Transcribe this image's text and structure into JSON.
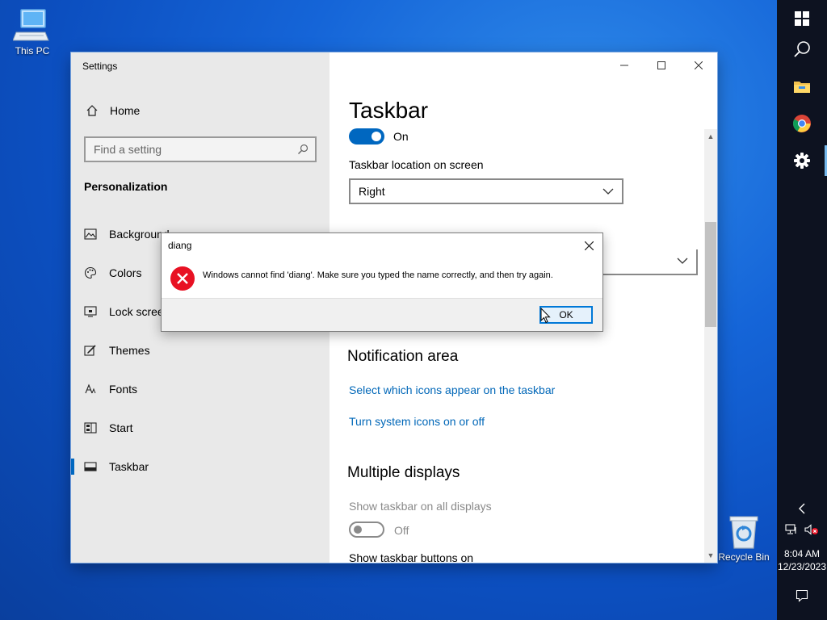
{
  "desktop": {
    "this_pc_label": "This PC",
    "recycle_bin_label": "Recycle Bin"
  },
  "settings": {
    "window_title": "Settings",
    "home_label": "Home",
    "search_placeholder": "Find a setting",
    "section_heading": "Personalization",
    "nav_items": [
      {
        "label": "Background",
        "icon": "picture-icon"
      },
      {
        "label": "Colors",
        "icon": "palette-icon"
      },
      {
        "label": "Lock screen",
        "icon": "lock-screen-icon"
      },
      {
        "label": "Themes",
        "icon": "brush-icon"
      },
      {
        "label": "Fonts",
        "icon": "font-icon"
      },
      {
        "label": "Start",
        "icon": "start-grid-icon"
      },
      {
        "label": "Taskbar",
        "icon": "taskbar-icon"
      }
    ],
    "active_nav": "Taskbar",
    "page_title": "Taskbar",
    "toggle_on_label": "On",
    "location_label": "Taskbar location on screen",
    "location_value": "Right",
    "notification_heading": "Notification area",
    "link_icons": "Select which icons appear on the taskbar",
    "link_system_icons": "Turn system icons on or off",
    "multiple_displays_heading": "Multiple displays",
    "show_all_displays_label": "Show taskbar on all displays",
    "toggle_off_label": "Off",
    "show_buttons_on_label": "Show taskbar buttons on"
  },
  "dialog": {
    "title": "diang",
    "message": "Windows cannot find 'diang'. Make sure you typed the name correctly, and then try again.",
    "ok_label": "OK"
  },
  "taskbar": {
    "time": "8:04 AM",
    "date": "12/23/2023",
    "accent_color": "#0067c0"
  }
}
